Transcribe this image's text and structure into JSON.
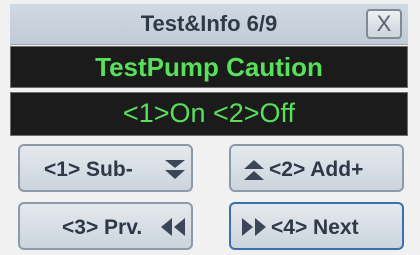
{
  "window": {
    "title": "Test&Info 6/9",
    "close_label": "X"
  },
  "display": {
    "line1": "TestPump Caution",
    "line2": "<1>On <2>Off"
  },
  "buttons": {
    "sub": "<1> Sub-",
    "add": "<2> Add+",
    "prev": "<3> Prv.",
    "next": "<4> Next"
  },
  "colors": {
    "display_bg": "#1b1b1b",
    "display_text": "#58e05a",
    "button_text": "#2d3946",
    "active_border": "#3a6fb0"
  },
  "icons": {
    "sub": "double-chevron-down-icon",
    "add": "double-chevron-up-icon",
    "prev": "rewind-icon",
    "next": "fast-forward-icon"
  }
}
